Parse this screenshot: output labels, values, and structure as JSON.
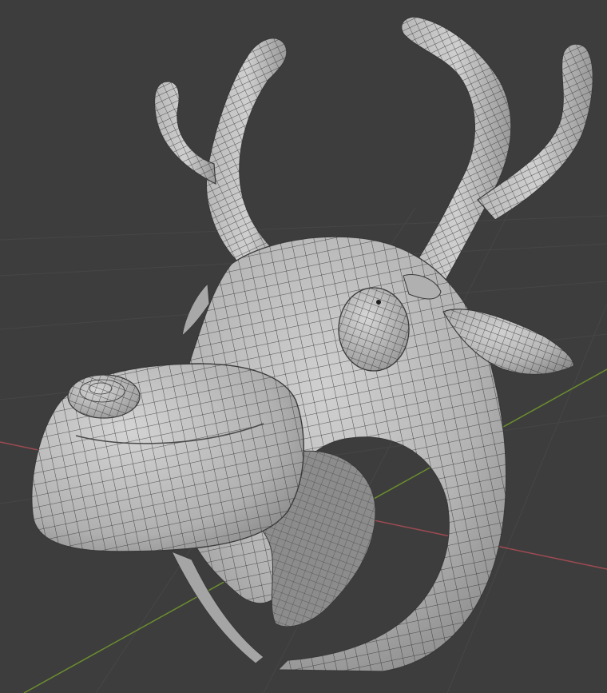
{
  "viewport": {
    "view_mode": "solid-wireframe",
    "background_color": "#3d3d3d",
    "grid_color": "#4a4a4a",
    "x_axis_color": "#9e4a52",
    "y_axis_color": "#6c8e2e",
    "mesh_color": "#c2c2c2",
    "wire_color": "#2d2d2d",
    "object": "reindeer-head-with-antlers"
  }
}
